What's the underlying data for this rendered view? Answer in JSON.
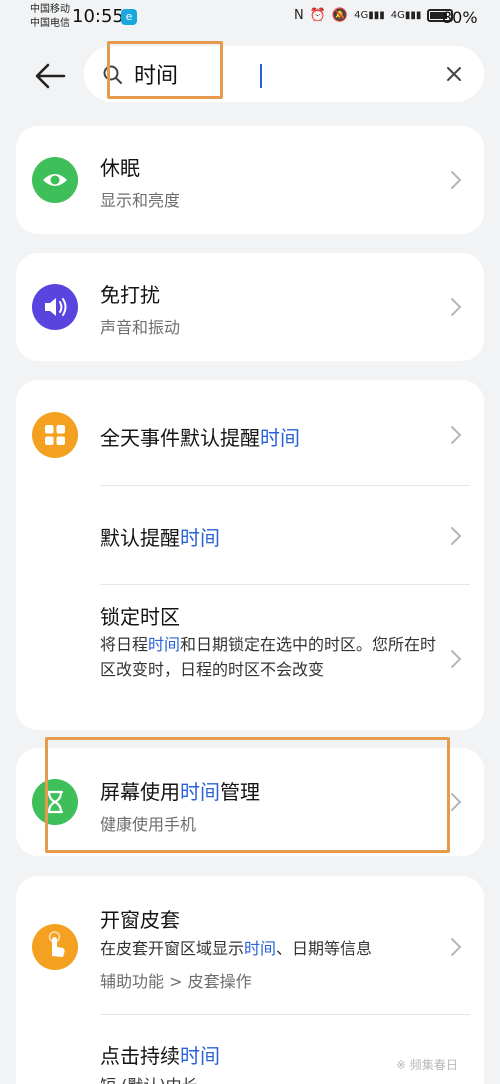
{
  "status_bar": {
    "carrier_1": "中国移动",
    "carrier_2": "中国电信",
    "time": "10:55",
    "app_badge": "e",
    "signal_1": "4G",
    "signal_2": "4G",
    "battery_percent": "80%"
  },
  "search": {
    "value": "时间",
    "icon": "search-icon",
    "clear_icon": "close-icon"
  },
  "results": [
    {
      "title": "休眠",
      "subtitle": "显示和亮度",
      "icon": "eye-icon",
      "icon_color": "#3fbf5a"
    },
    {
      "title": "免打扰",
      "subtitle": "声音和振动",
      "icon": "speaker-icon",
      "icon_color": "#5a44e0"
    },
    {
      "group": [
        {
          "title_prefix": "全天事件默认提醒",
          "title_hl": "时间",
          "icon": "apps-icon",
          "icon_color": "#f4a020"
        },
        {
          "title_prefix": "默认提醒",
          "title_hl": "时间"
        },
        {
          "title": "锁定时区",
          "desc_prefix": "将日程",
          "desc_hl": "时间",
          "desc_suffix": "和日期锁定在选中的时区。您所在时区改变时，日程的时区不会改变"
        }
      ]
    },
    {
      "title_prefix": "屏幕使用",
      "title_hl": "时间",
      "title_suffix": "管理",
      "subtitle": "健康使用手机",
      "icon": "hourglass-icon",
      "icon_color": "#3fbf5a"
    },
    {
      "group": [
        {
          "title": "开窗皮套",
          "desc_prefix": "在皮套开窗区域显示",
          "desc_hl": "时间",
          "desc_suffix": "、日期等信息",
          "path": "辅助功能 > 皮套操作",
          "icon": "touch-hand-icon",
          "icon_color": "#f4a020"
        },
        {
          "title_prefix": "点击持续",
          "title_hl": "时间",
          "desc_partial": "短 (默认)中长"
        }
      ]
    }
  ],
  "watermark": "※ 频集春日",
  "colors": {
    "highlight": "#2a63d8",
    "annotation_box": "#e59a4c",
    "background": "#f1f3f5"
  }
}
